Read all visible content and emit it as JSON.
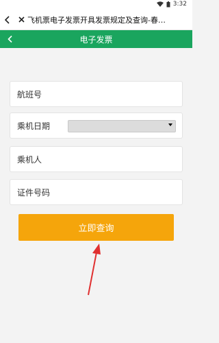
{
  "status_bar": {
    "time": "3:32"
  },
  "browser": {
    "title": "飞机票电子发票开具发票规定及查询-春…"
  },
  "header": {
    "title": "电子发票"
  },
  "form": {
    "flight_no_label": "航班号",
    "date_label": "乘机日期",
    "date_value": "",
    "passenger_label": "乘机人",
    "id_label": "证件号码"
  },
  "actions": {
    "query_label": "立即查询"
  },
  "colors": {
    "header_green": "#1aa55e",
    "button_orange": "#f5a50b",
    "annotation_red": "#e03030"
  }
}
